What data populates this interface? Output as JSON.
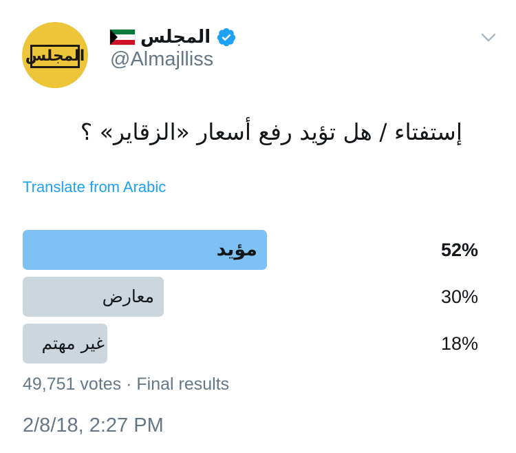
{
  "account": {
    "display_name": "المجلس",
    "handle": "@Almajlliss",
    "avatar_logo_text": "المجلس",
    "flag_icon": "kuwait-flag-icon",
    "verified_icon": "verified-badge-icon",
    "menu_icon": "chevron-down-icon"
  },
  "tweet": {
    "text": "إستفتاء / هل تؤيد رفع أسعار «الزقاير» ؟",
    "translate_label": "Translate from Arabic"
  },
  "poll": {
    "options": [
      {
        "label": "مؤيد",
        "percent_text": "52%",
        "percent": 52,
        "winner": true
      },
      {
        "label": "معارض",
        "percent_text": "30%",
        "percent": 30,
        "winner": false
      },
      {
        "label": "غير مهتم",
        "percent_text": "18%",
        "percent": 18,
        "winner": false
      }
    ],
    "votes": "49,751 votes",
    "separator": " · ",
    "status": "Final results"
  },
  "timestamp": "2/8/18, 2:27 PM",
  "colors": {
    "accent": "#1da1f2",
    "winner_bar": "#7ec1f5",
    "bar": "#ccd6dd",
    "secondary_text": "#657786",
    "avatar_bg": "#ecc53a"
  }
}
